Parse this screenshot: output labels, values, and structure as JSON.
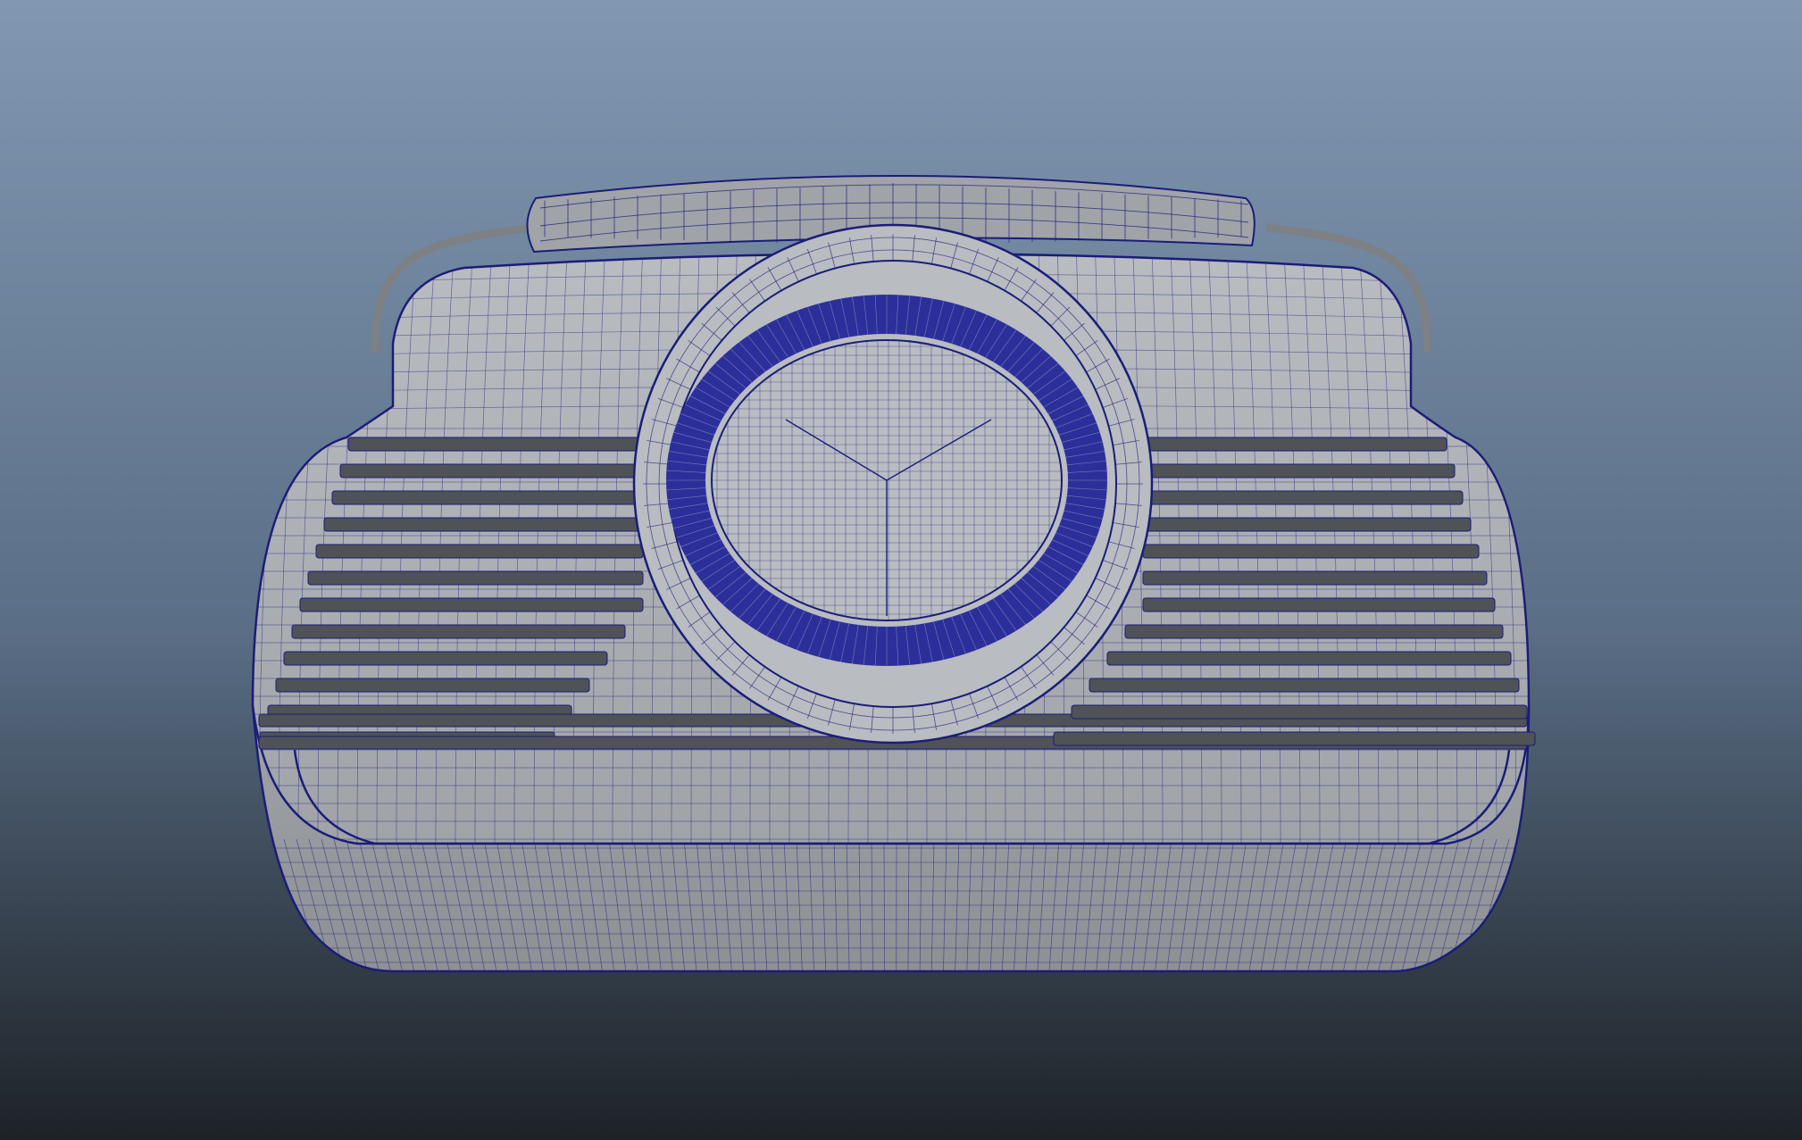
{
  "viewport": {
    "background": {
      "top": "#8198b2",
      "middle": "#5a6e86",
      "bottom": "#1d2227"
    },
    "shading": "wireframe-on-shaded"
  },
  "model": {
    "name": "retro-radio",
    "surface_color": "#a0a3a8",
    "surface_highlight": "#b9bcc1",
    "slot_color": "#4f5256",
    "wire_color": "#1a1d78",
    "speaker_ring_color": "#2c2f9a"
  }
}
